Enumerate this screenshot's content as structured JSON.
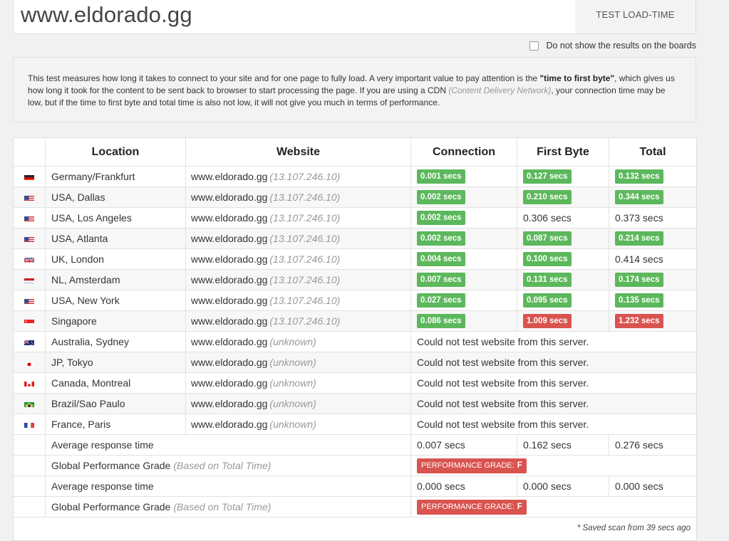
{
  "url": "www.eldorado.gg",
  "test_button": "TEST LOAD-TIME",
  "hide_results_label": "Do not show the results on the boards",
  "info": {
    "p1": "This test measures how long it takes to connect to your site and for one page to fully load. A very important value to pay attention is the ",
    "bold": "\"time to first byte\"",
    "p2": ", which gives us how long it took for the content to be sent back to browser to start processing the page. If you are using a CDN ",
    "cdn": "(Content Delivery Network)",
    "p3": ", your connection time may be low, but if the time to first byte and total time is also not low, it will not give you much in terms of performance."
  },
  "headers": {
    "location": "Location",
    "website": "Website",
    "connection": "Connection",
    "first_byte": "First Byte",
    "total": "Total"
  },
  "rows": [
    {
      "flag": "de",
      "location": "Germany/Frankfurt",
      "site": "www.eldorado.gg",
      "ip": "(13.107.246.10)",
      "conn": "0.001 secs",
      "conn_c": "g",
      "fb": "0.127 secs",
      "fb_c": "g",
      "tot": "0.132 secs",
      "tot_c": "g"
    },
    {
      "flag": "us",
      "location": "USA, Dallas",
      "site": "www.eldorado.gg",
      "ip": "(13.107.246.10)",
      "conn": "0.002 secs",
      "conn_c": "g",
      "fb": "0.210 secs",
      "fb_c": "g",
      "tot": "0.344 secs",
      "tot_c": "g"
    },
    {
      "flag": "us",
      "location": "USA, Los Angeles",
      "site": "www.eldorado.gg",
      "ip": "(13.107.246.10)",
      "conn": "0.002 secs",
      "conn_c": "g",
      "fb": "0.306 secs",
      "fb_c": "",
      "tot": "0.373 secs",
      "tot_c": ""
    },
    {
      "flag": "us",
      "location": "USA, Atlanta",
      "site": "www.eldorado.gg",
      "ip": "(13.107.246.10)",
      "conn": "0.002 secs",
      "conn_c": "g",
      "fb": "0.087 secs",
      "fb_c": "g",
      "tot": "0.214 secs",
      "tot_c": "g"
    },
    {
      "flag": "uk",
      "location": "UK, London",
      "site": "www.eldorado.gg",
      "ip": "(13.107.246.10)",
      "conn": "0.004 secs",
      "conn_c": "g",
      "fb": "0.100 secs",
      "fb_c": "g",
      "tot": "0.414 secs",
      "tot_c": ""
    },
    {
      "flag": "nl",
      "location": "NL, Amsterdam",
      "site": "www.eldorado.gg",
      "ip": "(13.107.246.10)",
      "conn": "0.007 secs",
      "conn_c": "g",
      "fb": "0.131 secs",
      "fb_c": "g",
      "tot": "0.174 secs",
      "tot_c": "g"
    },
    {
      "flag": "us",
      "location": "USA, New York",
      "site": "www.eldorado.gg",
      "ip": "(13.107.246.10)",
      "conn": "0.027 secs",
      "conn_c": "g",
      "fb": "0.095 secs",
      "fb_c": "g",
      "tot": "0.135 secs",
      "tot_c": "g"
    },
    {
      "flag": "sg",
      "location": "Singapore",
      "site": "www.eldorado.gg",
      "ip": "(13.107.246.10)",
      "conn": "0.086 secs",
      "conn_c": "g",
      "fb": "1.009 secs",
      "fb_c": "r",
      "tot": "1.232 secs",
      "tot_c": "r"
    },
    {
      "flag": "au",
      "location": "Australia, Sydney",
      "site": "www.eldorado.gg",
      "ip": "(unknown)",
      "error": "Could not test website from this server."
    },
    {
      "flag": "jp",
      "location": "JP, Tokyo",
      "site": "www.eldorado.gg",
      "ip": "(unknown)",
      "error": "Could not test website from this server."
    },
    {
      "flag": "ca",
      "location": "Canada, Montreal",
      "site": "www.eldorado.gg",
      "ip": "(unknown)",
      "error": "Could not test website from this server."
    },
    {
      "flag": "br",
      "location": "Brazil/Sao Paulo",
      "site": "www.eldorado.gg",
      "ip": "(unknown)",
      "error": "Could not test website from this server."
    },
    {
      "flag": "fr",
      "location": "France, Paris",
      "site": "www.eldorado.gg",
      "ip": "(unknown)",
      "error": "Could not test website from this server."
    }
  ],
  "summary": [
    {
      "type": "avg",
      "label": "Average response time",
      "conn": "0.007 secs",
      "fb": "0.162 secs",
      "tot": "0.276 secs"
    },
    {
      "type": "grade",
      "label": "Global Performance Grade",
      "note": "(Based on Total Time)",
      "grade_label": "PERFORMANCE GRADE:",
      "grade": "F"
    },
    {
      "type": "avg",
      "label": "Average response time",
      "conn": "0.000 secs",
      "fb": "0.000 secs",
      "tot": "0.000 secs"
    },
    {
      "type": "grade",
      "label": "Global Performance Grade",
      "note": "(Based on Total Time)",
      "grade_label": "PERFORMANCE GRADE:",
      "grade": "F"
    }
  ],
  "saved_note": "* Saved scan from 39 secs ago",
  "colors": {
    "good": "#5cb85c",
    "bad": "#d9534f"
  }
}
